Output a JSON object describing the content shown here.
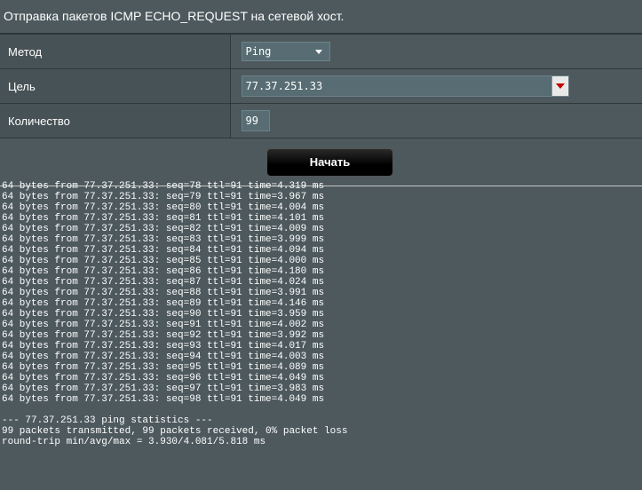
{
  "header": {
    "title": "Отправка пакетов ICMP ECHO_REQUEST на сетевой хост."
  },
  "form": {
    "method_label": "Метод",
    "method_value": "Ping",
    "target_label": "Цель",
    "target_value": "77.37.251.33",
    "count_label": "Количество",
    "count_value": "99"
  },
  "actions": {
    "start_label": "Начать"
  },
  "output": {
    "lines": [
      "64 bytes from 77.37.251.33: seq=78 ttl=91 time=4.319 ms",
      "64 bytes from 77.37.251.33: seq=79 ttl=91 time=3.967 ms",
      "64 bytes from 77.37.251.33: seq=80 ttl=91 time=4.004 ms",
      "64 bytes from 77.37.251.33: seq=81 ttl=91 time=4.101 ms",
      "64 bytes from 77.37.251.33: seq=82 ttl=91 time=4.009 ms",
      "64 bytes from 77.37.251.33: seq=83 ttl=91 time=3.999 ms",
      "64 bytes from 77.37.251.33: seq=84 ttl=91 time=4.094 ms",
      "64 bytes from 77.37.251.33: seq=85 ttl=91 time=4.000 ms",
      "64 bytes from 77.37.251.33: seq=86 ttl=91 time=4.180 ms",
      "64 bytes from 77.37.251.33: seq=87 ttl=91 time=4.024 ms",
      "64 bytes from 77.37.251.33: seq=88 ttl=91 time=3.991 ms",
      "64 bytes from 77.37.251.33: seq=89 ttl=91 time=4.146 ms",
      "64 bytes from 77.37.251.33: seq=90 ttl=91 time=3.959 ms",
      "64 bytes from 77.37.251.33: seq=91 ttl=91 time=4.002 ms",
      "64 bytes from 77.37.251.33: seq=92 ttl=91 time=3.992 ms",
      "64 bytes from 77.37.251.33: seq=93 ttl=91 time=4.017 ms",
      "64 bytes from 77.37.251.33: seq=94 ttl=91 time=4.003 ms",
      "64 bytes from 77.37.251.33: seq=95 ttl=91 time=4.089 ms",
      "64 bytes from 77.37.251.33: seq=96 ttl=91 time=4.049 ms",
      "64 bytes from 77.37.251.33: seq=97 ttl=91 time=3.983 ms",
      "64 bytes from 77.37.251.33: seq=98 ttl=91 time=4.049 ms",
      "",
      "--- 77.37.251.33 ping statistics ---",
      "99 packets transmitted, 99 packets received, 0% packet loss",
      "round-trip min/avg/max = 3.930/4.081/5.818 ms"
    ]
  },
  "colors": {
    "background": "#4d595d",
    "label_cell": "#475256",
    "combo_arrow": "#c00000",
    "button": "#000000"
  }
}
